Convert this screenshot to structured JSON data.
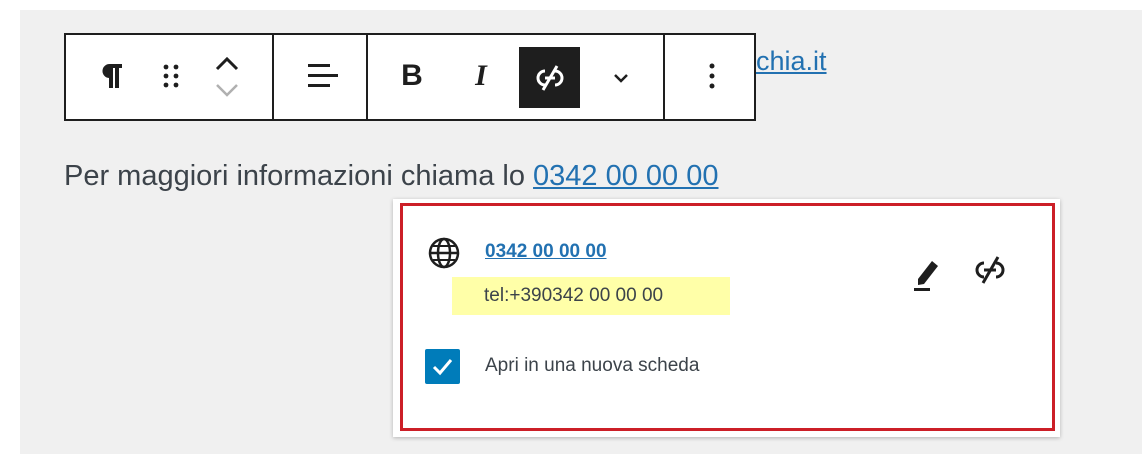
{
  "background_link": {
    "text": "chia.it"
  },
  "toolbar": {
    "buttons": [
      {
        "name": "paragraph",
        "icon": "paragraph-icon"
      },
      {
        "name": "drag",
        "icon": "drag-handle-icon"
      },
      {
        "name": "move",
        "icon": "move-up-down-icon"
      },
      {
        "name": "align",
        "icon": "align-left-icon"
      },
      {
        "name": "bold",
        "label": "B"
      },
      {
        "name": "italic",
        "label": "I"
      },
      {
        "name": "unlink",
        "icon": "unlink-icon",
        "active": true
      },
      {
        "name": "more-formatting",
        "icon": "chevron-down-icon"
      },
      {
        "name": "options",
        "icon": "more-vertical-icon"
      }
    ]
  },
  "paragraph": {
    "text": "Per maggiori informazioni chiama lo ",
    "link": "0342 00 00 00"
  },
  "popover": {
    "url_title": "0342 00 00 00",
    "href": "tel:+390342 00 00 00",
    "open_new_tab": {
      "label": "Apri in una nuova scheda",
      "checked": true
    }
  },
  "colors": {
    "accent": "#007cba",
    "link": "#2271b1",
    "highlight": "#ffffa8",
    "outline": "#cc1f27",
    "active_button": "#1e1e1e"
  }
}
